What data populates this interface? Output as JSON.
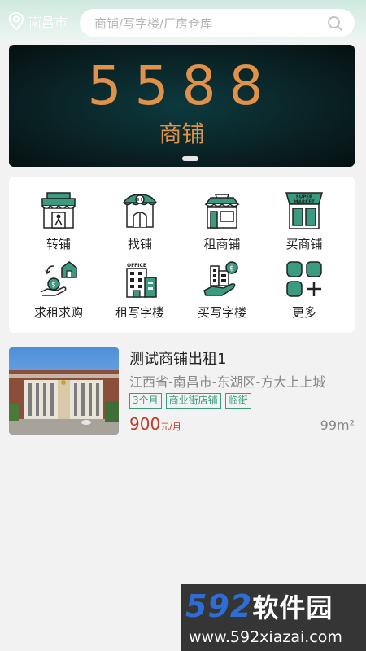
{
  "header": {
    "city": "南昌市",
    "search_placeholder": "商铺/写字楼/厂房仓库"
  },
  "banner": {
    "number": "5588",
    "subtitle": "商铺"
  },
  "categories": [
    {
      "label": "转铺",
      "icon": "shop-transfer-icon"
    },
    {
      "label": "找铺",
      "icon": "find-shop-icon"
    },
    {
      "label": "租商铺",
      "icon": "rent-shop-icon"
    },
    {
      "label": "买商铺",
      "icon": "supermarket-icon"
    },
    {
      "label": "求租求购",
      "icon": "seek-rent-buy-icon"
    },
    {
      "label": "租写字楼",
      "icon": "office-building-icon"
    },
    {
      "label": "买写字楼",
      "icon": "buy-office-icon"
    },
    {
      "label": "更多",
      "icon": "more-grid-icon"
    }
  ],
  "banner_icon_text": {
    "office": "OFFICE",
    "super": "SUPER",
    "market": "MARKET"
  },
  "listing": {
    "title": "测试商铺出租1",
    "address": "江西省-南昌市-东湖区-方大上上城",
    "tags": [
      "3个月",
      "商业街店铺",
      "临街"
    ],
    "price_value": "900",
    "price_unit": "元/月",
    "area": "99m²"
  },
  "watermark": {
    "brand_digits": "592",
    "brand_text": "软件园",
    "url": "www.592xiazai.com"
  },
  "colors": {
    "accent": "#3a9b80",
    "price": "#c0392b",
    "banner_text": "#e0924a"
  }
}
